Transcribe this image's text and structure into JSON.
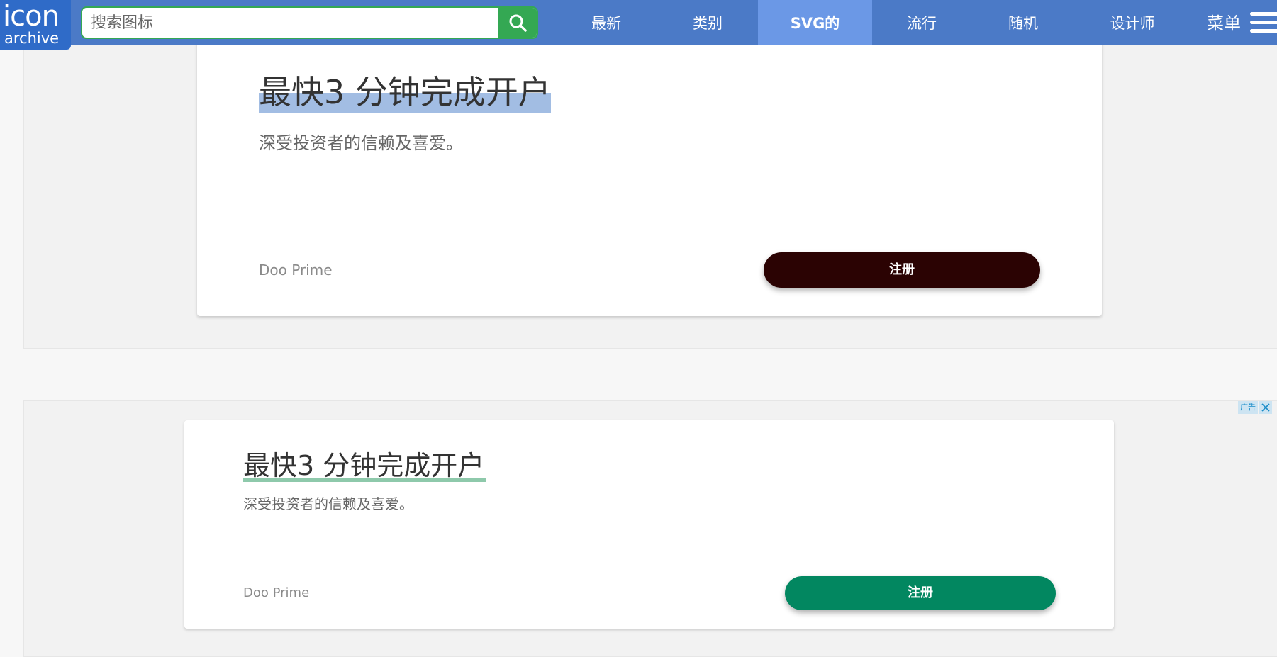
{
  "logo": {
    "top": "icon",
    "bottom": "archive"
  },
  "search": {
    "placeholder": "搜索图标",
    "value": ""
  },
  "nav": {
    "items": [
      {
        "label": "最新"
      },
      {
        "label": "类别"
      },
      {
        "label": "SVG的"
      },
      {
        "label": "流行"
      },
      {
        "label": "随机"
      },
      {
        "label": "设计师"
      }
    ],
    "active": "SVG的",
    "menu_label": "菜单"
  },
  "ads": [
    {
      "headline": "最快3 分钟完成开户",
      "subtext": "深受投资者的信赖及喜爱。",
      "advertiser": "Doo Prime",
      "cta": "注册",
      "cta_color": "#2b0303",
      "highlight_color": "#a2bde3"
    },
    {
      "headline": "最快3 分钟完成开户",
      "subtext": "深受投资者的信赖及喜爱。",
      "advertiser": "Doo Prime",
      "cta": "注册",
      "cta_color": "#028760",
      "highlight_color": "#8ec9ab",
      "ad_badge": "广告"
    }
  ],
  "colors": {
    "topbar": "#4b7ac7",
    "nav_active": "#6b98e6",
    "search_accent": "#34a853"
  }
}
